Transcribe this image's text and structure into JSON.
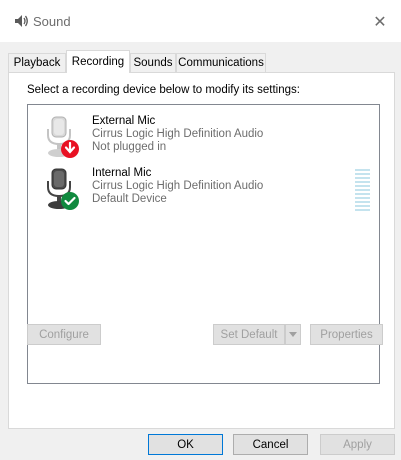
{
  "window": {
    "title": "Sound",
    "icon": "speaker-icon",
    "close_symbol": "✕"
  },
  "tabs": [
    {
      "label": "Playback",
      "active": false
    },
    {
      "label": "Recording",
      "active": true
    },
    {
      "label": "Sounds",
      "active": false
    },
    {
      "label": "Communications",
      "active": false
    }
  ],
  "panel": {
    "instructions": "Select a recording device below to modify its settings:"
  },
  "devices": [
    {
      "name": "External Mic",
      "driver": "Cirrus Logic High Definition Audio",
      "status": "Not plugged in",
      "status_icon": "red-down-arrow-icon",
      "enabled": false
    },
    {
      "name": "Internal Mic",
      "driver": "Cirrus Logic High Definition Audio",
      "status": "Default Device",
      "status_icon": "green-check-icon",
      "enabled": true,
      "level_percent": 0
    }
  ],
  "panel_buttons": {
    "configure": "Configure",
    "set_default": "Set Default",
    "properties": "Properties"
  },
  "dialog_buttons": {
    "ok": "OK",
    "cancel": "Cancel",
    "apply": "Apply"
  },
  "colors": {
    "status_unplugged": "#e81123",
    "status_default": "#10893e",
    "meter_idle": "#c4e3ee",
    "focus_border": "#0078d7"
  }
}
